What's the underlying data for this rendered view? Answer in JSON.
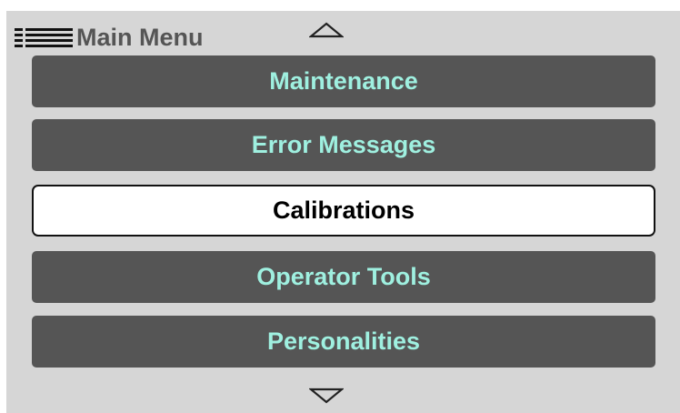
{
  "header": {
    "title": "Main Menu",
    "menu_icon": "hamburger-list-icon",
    "scroll_up_icon": "triangle-up-outline-icon"
  },
  "menu": {
    "items": [
      {
        "label": "Maintenance",
        "selected": false
      },
      {
        "label": "Error Messages",
        "selected": false
      },
      {
        "label": "Calibrations",
        "selected": true
      },
      {
        "label": "Operator Tools",
        "selected": false
      },
      {
        "label": "Personalities",
        "selected": false
      }
    ]
  },
  "footer": {
    "scroll_down_icon": "triangle-down-outline-icon"
  },
  "colors": {
    "screen_background": "#d6d6d6",
    "item_background": "#555555",
    "item_text": "#9ff0e0",
    "selected_background": "#ffffff",
    "selected_text": "#000000",
    "title_text": "#555555"
  }
}
